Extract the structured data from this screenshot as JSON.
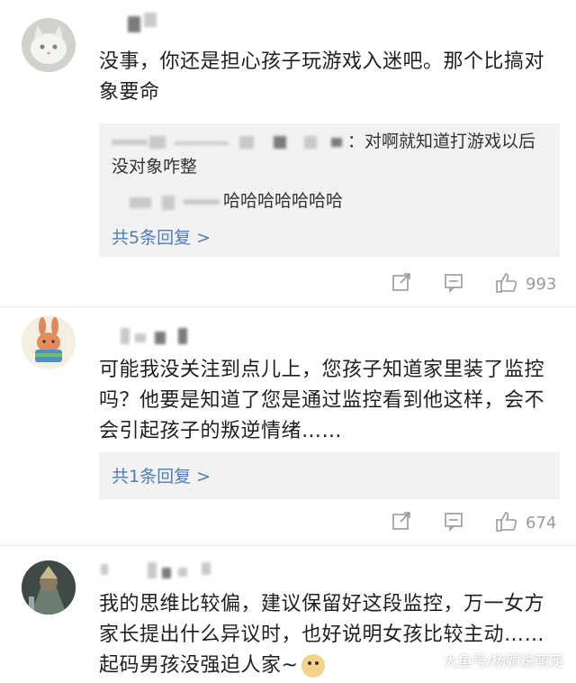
{
  "comments": [
    {
      "text": "没事，你还是担心孩子玩游戏入迷吧。那个比搞对象要命",
      "replies": [
        {
          "text": "：对啊就知道打游戏以后没对象咋整"
        },
        {
          "text": "哈哈哈哈哈哈哈"
        }
      ],
      "more_replies": "共5条回复 >",
      "like_count": "993"
    },
    {
      "text": "可能我没关注到点儿上，您孩子知道家里装了监控吗？他要是知道了您是通过监控看到他这样，会不会引起孩子的叛逆情绪……",
      "more_replies": "共1条回复 >",
      "like_count": "674"
    },
    {
      "text": "我的思维比较偏，建议保留好这段监控，万一女方家长提出什么异议时，也好说明女孩比较主动……起码男孩没强迫人家~"
    }
  ],
  "icons": {
    "share": "share-icon",
    "comment": "comment-icon",
    "like": "thumbs-up-icon",
    "emoji": "dog-face-emoji"
  },
  "watermark": "大鱼号/杨颖说萌宠",
  "colors": {
    "link": "#4d7dbf",
    "reply_bg": "#f2f2f2",
    "meta": "#9a9a9a"
  }
}
